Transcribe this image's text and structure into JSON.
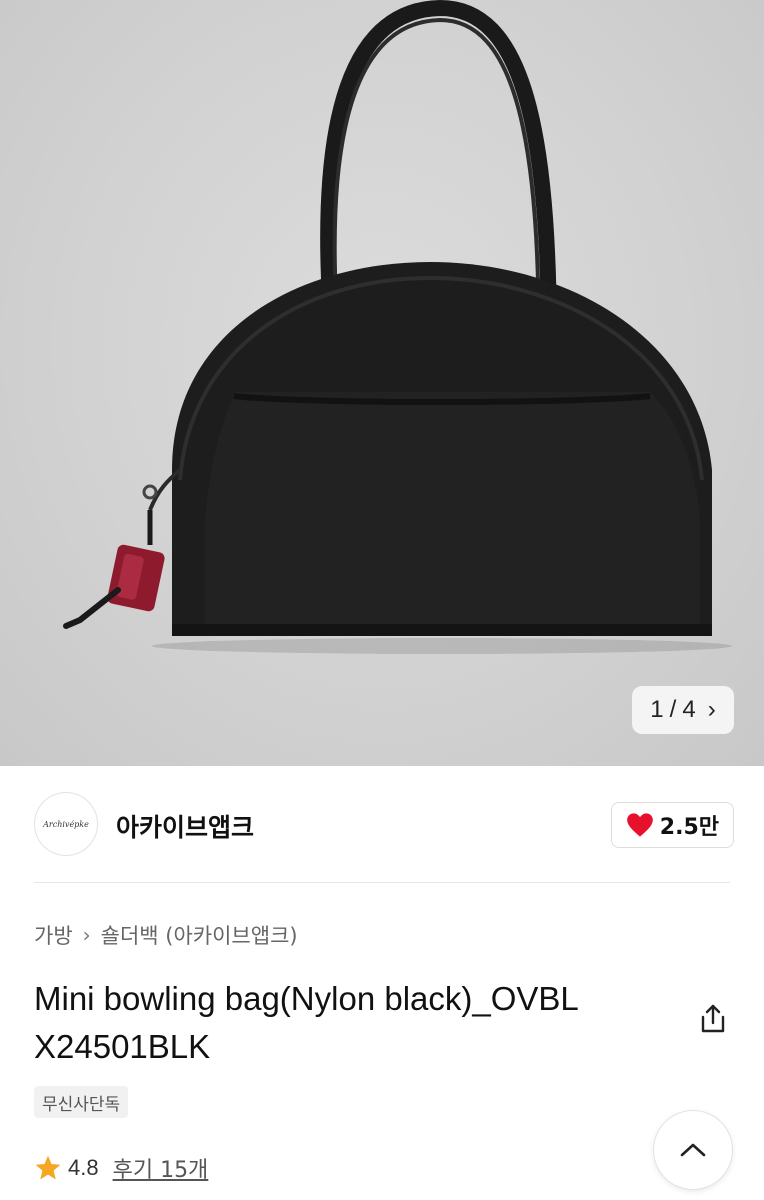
{
  "gallery": {
    "current": "1",
    "separator": "/",
    "total": "4"
  },
  "brand": {
    "logo_text": "Archivépke",
    "name": "아카이브앱크",
    "likes": "2.5만"
  },
  "breadcrumb": {
    "category": "가방",
    "subcategory": "숄더백 (아카이브앱크)"
  },
  "product": {
    "title_line1": "Mini bowling bag(Nylon black)_OVBL",
    "title_line2": "X24501BLK",
    "badge": "무신사단독"
  },
  "rating": {
    "score": "4.8",
    "reviews": "후기 15개"
  },
  "icons": {
    "heart": "heart-icon",
    "share": "share-icon",
    "star": "star-icon",
    "next": "chevron-right-icon",
    "scroll_top": "chevron-up-icon"
  },
  "colors": {
    "heart": "#e8112d",
    "star": "#f5a623",
    "bag": "#1c1c1c",
    "charm": "#9b1e34"
  }
}
